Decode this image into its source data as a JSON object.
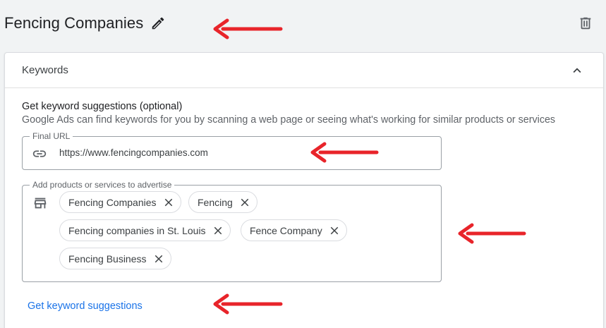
{
  "ad_group": {
    "title": "Fencing Companies",
    "edit_icon": "pencil-icon",
    "delete_icon": "trash-icon"
  },
  "keywords_panel": {
    "title": "Keywords",
    "collapse_icon": "chevron-up-icon",
    "suggestions_heading": "Get keyword suggestions (optional)",
    "suggestions_description": "Google Ads can find keywords for you by scanning a web page or seeing what's working for similar products or services",
    "final_url": {
      "label": "Final URL",
      "value": "https://www.fencingcompanies.com",
      "icon": "link-icon"
    },
    "products": {
      "label": "Add products or services to advertise",
      "icon": "storefront-icon",
      "chips": [
        "Fencing Companies",
        "Fencing",
        "Fencing companies in St. Louis",
        "Fence Company",
        "Fencing Business"
      ]
    },
    "get_suggestions_label": "Get keyword suggestions"
  },
  "colors": {
    "accent": "#1a73e8",
    "arrow": "#e8242a",
    "background": "#f1f3f4"
  }
}
